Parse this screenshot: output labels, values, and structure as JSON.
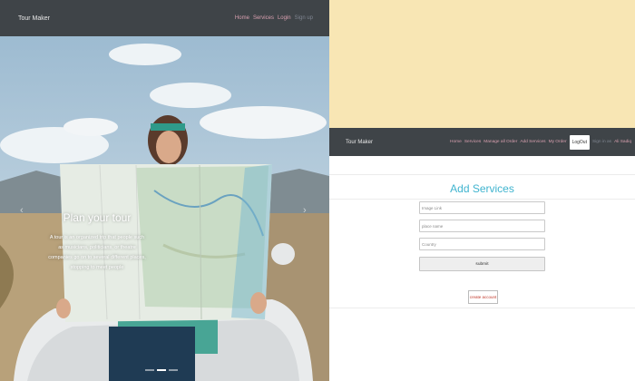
{
  "left": {
    "brand": "Tour Maker",
    "nav": [
      "Home",
      "Services",
      "Login",
      "Sign up"
    ],
    "hero": {
      "title": "Plan your tour",
      "text": "A tour is an organized trip that people such as musicians, politicians, or theatre companies go on to several different places, stopping to meet people",
      "prev_icon": "‹",
      "next_icon": "›"
    }
  },
  "right": {
    "brand": "Tour Maker",
    "nav": [
      "Home",
      "Services",
      "Manage all Order",
      "Add Services",
      "My Order"
    ],
    "logout": "LogOut",
    "user": [
      "Sign in as",
      "Ali Sadiq"
    ],
    "form": {
      "title": "Add Services",
      "image_placeholder": "Image Link",
      "place_placeholder": "place name",
      "country_placeholder": "Country",
      "submit": "submit"
    },
    "create_account": "create account"
  },
  "colors": {
    "navbar": "#3f4448",
    "yellow": "#f8e6b4",
    "accent": "#40b4cf",
    "link": "#d9a0b0",
    "danger": "#c0392b"
  }
}
